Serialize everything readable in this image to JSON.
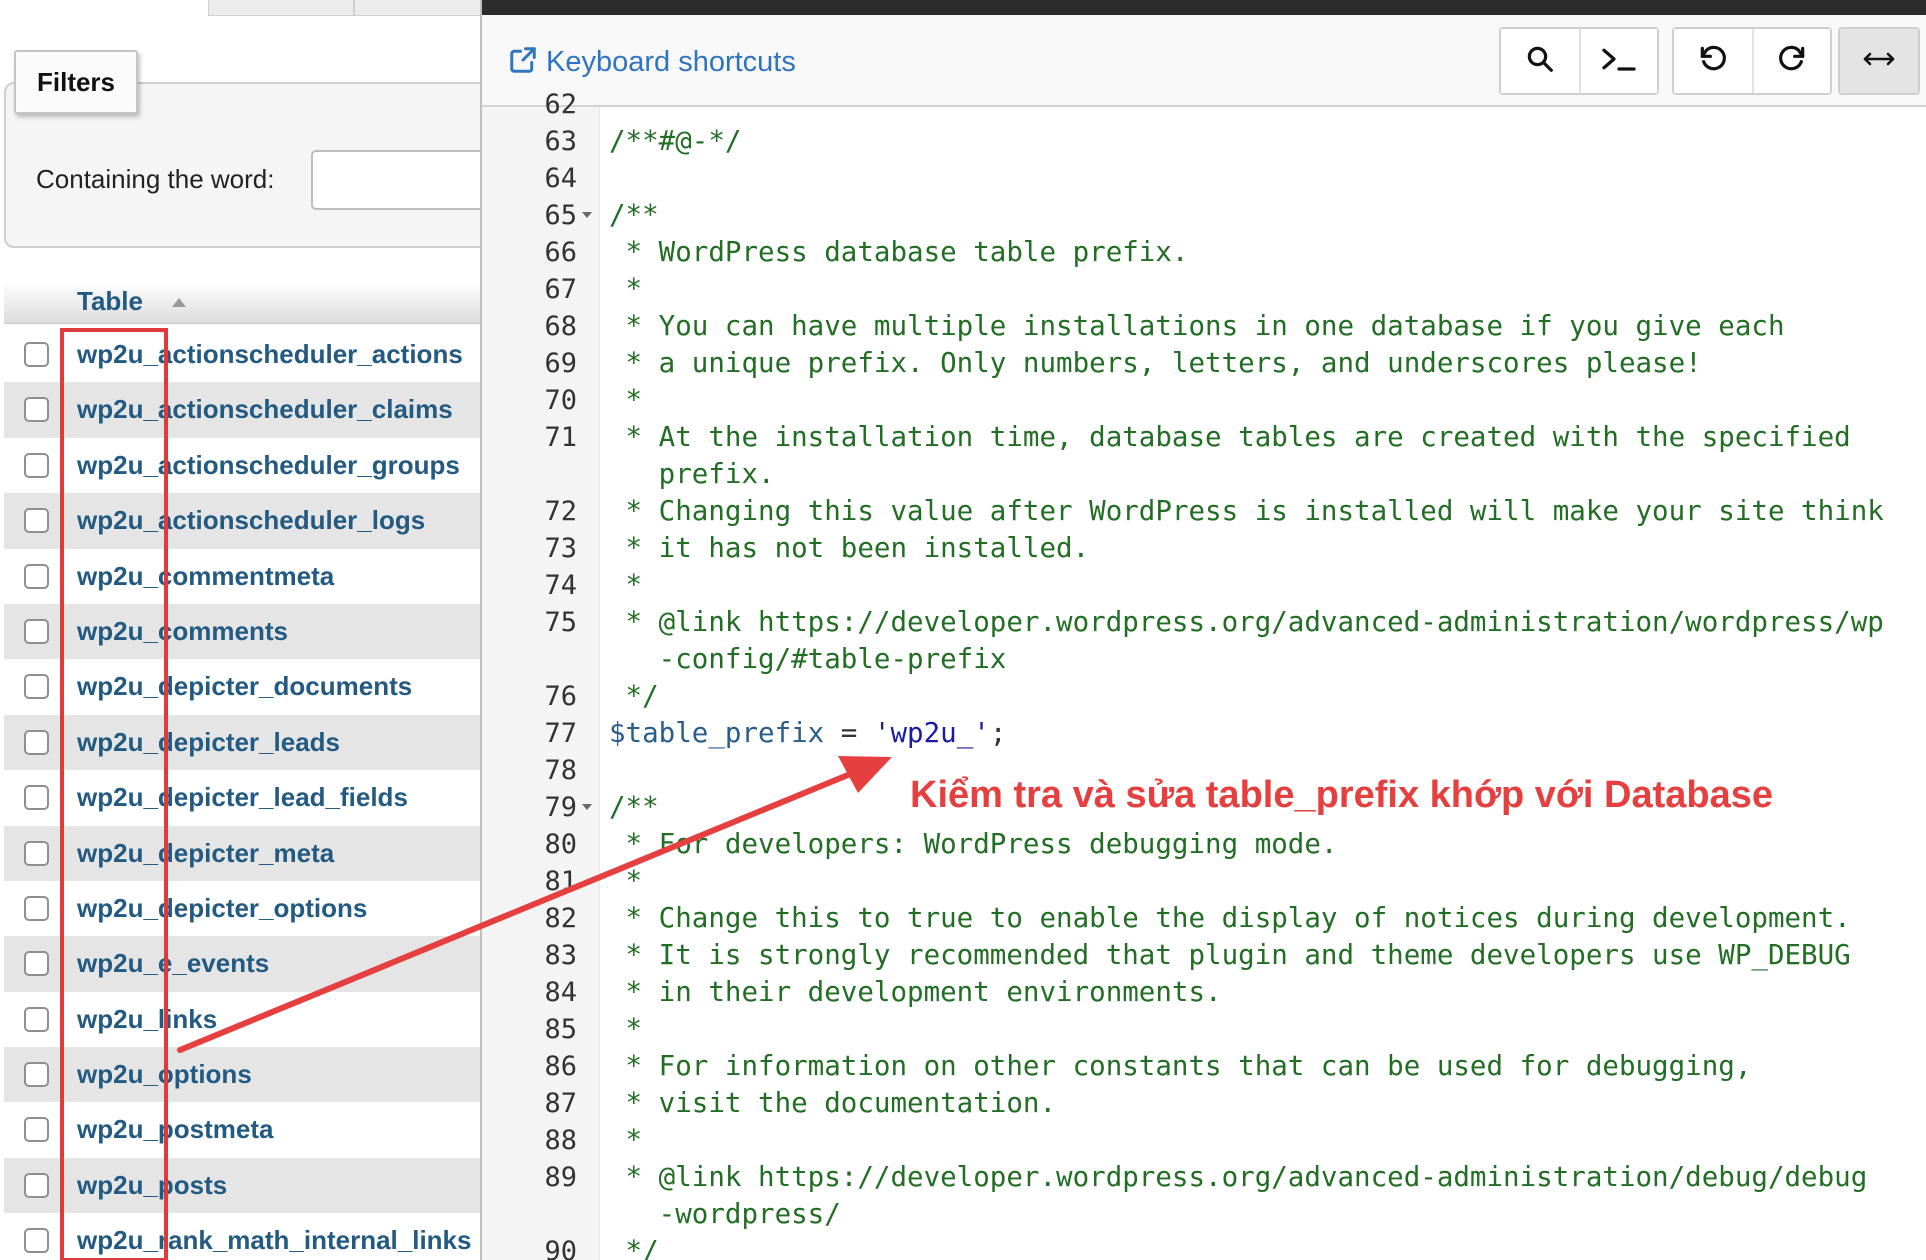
{
  "sidebar": {
    "filters_legend": "Filters",
    "filter_label": "Containing the word:",
    "filter_value": "",
    "table_header": "Table",
    "tables": [
      "wp2u_actionscheduler_actions",
      "wp2u_actionscheduler_claims",
      "wp2u_actionscheduler_groups",
      "wp2u_actionscheduler_logs",
      "wp2u_commentmeta",
      "wp2u_comments",
      "wp2u_depicter_documents",
      "wp2u_depicter_leads",
      "wp2u_depicter_lead_fields",
      "wp2u_depicter_meta",
      "wp2u_depicter_options",
      "wp2u_e_events",
      "wp2u_links",
      "wp2u_options",
      "wp2u_postmeta",
      "wp2u_posts",
      "wp2u_rank_math_internal_links"
    ]
  },
  "editor": {
    "toolbar": {
      "keyboard_shortcuts": "Keyboard shortcuts",
      "icons": [
        "search-icon",
        "terminal-icon",
        "undo-icon",
        "redo-icon",
        "expand-horizontal-icon"
      ]
    },
    "lines": [
      {
        "num": "62",
        "text": ""
      },
      {
        "num": "63",
        "text": "/**#@-*/"
      },
      {
        "num": "64",
        "text": ""
      },
      {
        "num": "65",
        "text": "/**",
        "fold": true
      },
      {
        "num": "66",
        "text": " * WordPress database table prefix."
      },
      {
        "num": "67",
        "text": " *"
      },
      {
        "num": "68",
        "text": " * You can have multiple installations in one database if you give each"
      },
      {
        "num": "69",
        "text": " * a unique prefix. Only numbers, letters, and underscores please!"
      },
      {
        "num": "70",
        "text": " *"
      },
      {
        "num": "71",
        "text": " * At the installation time, database tables are created with the specified"
      },
      {
        "num": "",
        "text": "   prefix."
      },
      {
        "num": "72",
        "text": " * Changing this value after WordPress is installed will make your site think"
      },
      {
        "num": "73",
        "text": " * it has not been installed."
      },
      {
        "num": "74",
        "text": " *"
      },
      {
        "num": "75",
        "text": " * @link https://developer.wordpress.org/advanced-administration/wordpress/wp"
      },
      {
        "num": "",
        "text": "   -config/#table-prefix"
      },
      {
        "num": "76",
        "text": " */"
      },
      {
        "num": "77",
        "text": "",
        "special": "prefix"
      },
      {
        "num": "78",
        "text": ""
      },
      {
        "num": "79",
        "text": "/**",
        "fold": true
      },
      {
        "num": "80",
        "text": " * For developers: WordPress debugging mode."
      },
      {
        "num": "81",
        "text": " *"
      },
      {
        "num": "82",
        "text": " * Change this to true to enable the display of notices during development."
      },
      {
        "num": "83",
        "text": " * It is strongly recommended that plugin and theme developers use WP_DEBUG"
      },
      {
        "num": "84",
        "text": " * in their development environments."
      },
      {
        "num": "85",
        "text": " *"
      },
      {
        "num": "86",
        "text": " * For information on other constants that can be used for debugging,"
      },
      {
        "num": "87",
        "text": " * visit the documentation."
      },
      {
        "num": "88",
        "text": " *"
      },
      {
        "num": "89",
        "text": " * @link https://developer.wordpress.org/advanced-administration/debug/debug"
      },
      {
        "num": "",
        "text": "   -wordpress/"
      },
      {
        "num": "90",
        "text": " */"
      }
    ],
    "prefix_line": {
      "var": "$table_prefix",
      "op": " = ",
      "str": "'wp2u_'",
      "end": ";"
    }
  },
  "annotation": {
    "text": "Kiểm tra và sửa table_prefix khớp với Database",
    "color": "#e5403f"
  }
}
